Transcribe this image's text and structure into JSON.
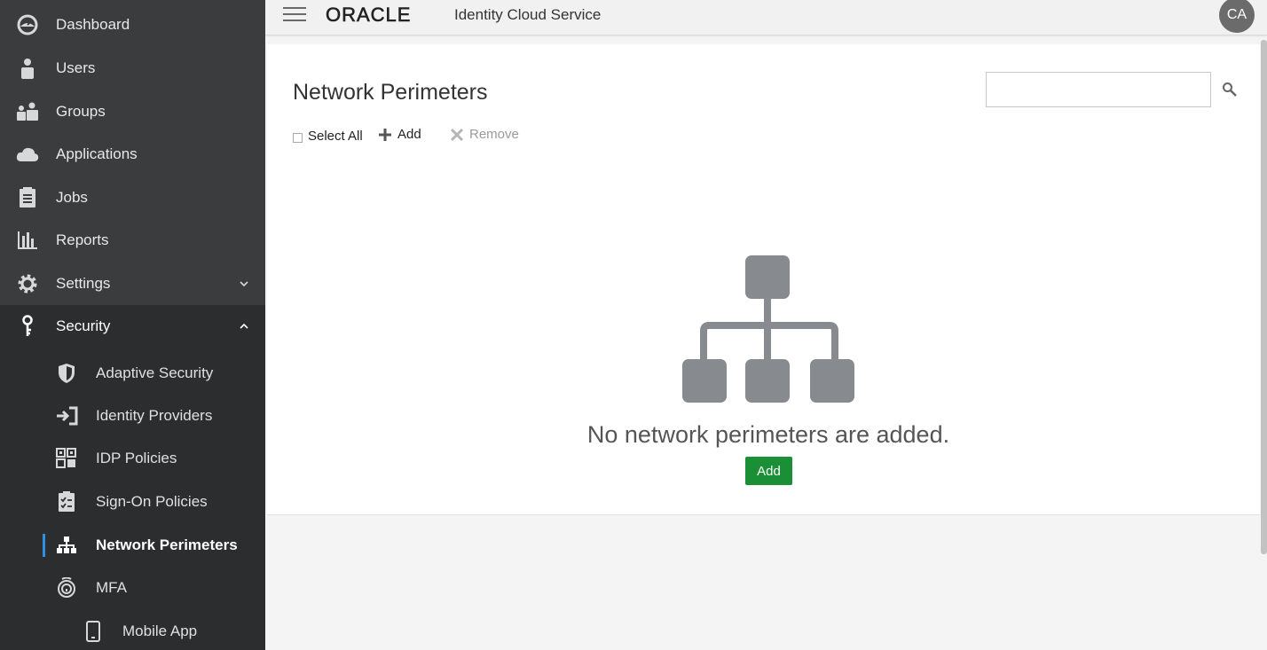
{
  "header": {
    "brand_logo": "ORACLE",
    "brand_name": "Identity Cloud Service",
    "avatar_initials": "CA"
  },
  "sidebar": {
    "items": [
      {
        "label": "Dashboard",
        "icon": "dashboard-icon"
      },
      {
        "label": "Users",
        "icon": "user-icon"
      },
      {
        "label": "Groups",
        "icon": "groups-icon"
      },
      {
        "label": "Applications",
        "icon": "cloud-icon"
      },
      {
        "label": "Jobs",
        "icon": "jobs-icon"
      },
      {
        "label": "Reports",
        "icon": "bar-chart-icon"
      },
      {
        "label": "Settings",
        "icon": "gear-icon"
      },
      {
        "label": "Security",
        "icon": "key-icon"
      }
    ],
    "security_items": [
      {
        "label": "Adaptive Security",
        "icon": "shield-icon"
      },
      {
        "label": "Identity Providers",
        "icon": "sign-in-icon"
      },
      {
        "label": "IDP Policies",
        "icon": "grid-policy-icon"
      },
      {
        "label": "Sign-On Policies",
        "icon": "checklist-icon"
      },
      {
        "label": "Network Perimeters",
        "icon": "network-icon"
      },
      {
        "label": "MFA",
        "icon": "fingerprint-icon"
      },
      {
        "label": "Mobile App",
        "icon": "mobile-icon"
      }
    ]
  },
  "main": {
    "title": "Network Perimeters",
    "toolbar": {
      "select_all": "Select All",
      "add": "Add",
      "remove": "Remove"
    },
    "empty_message": "No network perimeters are added.",
    "add_button": "Add"
  },
  "colors": {
    "sidebar_bg": "#3a3c3e",
    "active_accent": "#2f8fe3",
    "primary_button": "#1a8f35"
  }
}
